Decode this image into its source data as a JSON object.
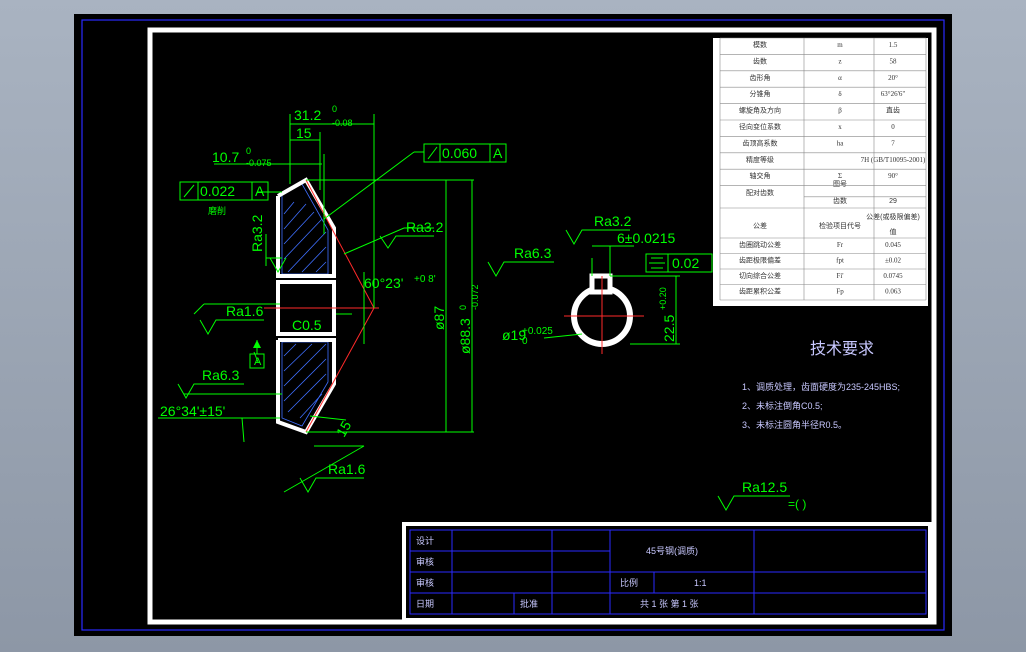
{
  "dims": {
    "d1": "31.2",
    "d1_upper": "0",
    "d1_lower": "-0.08",
    "d2": "15",
    "d3": "10.7",
    "d3_upper": "0",
    "d3_lower": "-0.075",
    "flatness1": "0.022",
    "flatness1_datum": "A",
    "flatness2": "0.060",
    "flatness2_datum": "A",
    "sym": "0.02",
    "angle1": "60°23'",
    "angle1_tol": "+0 8'",
    "angle2": "26°34'±15'",
    "chamfer": "C0.5",
    "dia87": "ø87",
    "dia88": "ø88.3",
    "dia88_upper": "0",
    "dia88_lower": "-0.072",
    "bore": "ø19",
    "bore_upper": "+0.025",
    "bore_lower": "0",
    "keywidth": "6±0.0215",
    "keydepth": "22.5",
    "keydepth_tol": "+0.20",
    "dim15b": "15",
    "datum": "A",
    "cn_label": "磨削"
  },
  "roughness": {
    "r1": "Ra3.2",
    "r2": "Ra3.2",
    "r3": "Ra6.3",
    "r4": "Ra1.6",
    "r5": "Ra6.3",
    "r6": "Ra1.6",
    "r7": "Ra3.2",
    "r_general": "Ra12.5",
    "r_general_suffix": "=( )"
  },
  "param_table": [
    [
      "模数",
      "m",
      "1.5"
    ],
    [
      "齿数",
      "z",
      "58"
    ],
    [
      "齿形角",
      "α",
      "20°"
    ],
    [
      "分锥角",
      "δ",
      "63°26'6\""
    ],
    [
      "螺旋角及方向",
      "β",
      "直齿"
    ],
    [
      "径向变位系数",
      "x",
      "0"
    ],
    [
      "齿顶高系数",
      "ha",
      "7"
    ],
    [
      "精度等级",
      "",
      "7H (GB/T10095-2001)"
    ],
    [
      "轴交角",
      "Σ",
      "90°"
    ]
  ],
  "mate_table": {
    "label": "配对齿数",
    "sub1": "图号",
    "sub2": "齿数",
    "value": "29"
  },
  "tol_header": {
    "col1": "公差",
    "col2": "检验项目代号",
    "col3a": "公差(或极限偏差)",
    "col3b": "值"
  },
  "tol_table": [
    [
      "齿圈跳动公差",
      "Fr",
      "0.045"
    ],
    [
      "齿距极限偏差",
      "fpt",
      "±0.02"
    ],
    [
      "切向综合公差",
      "Fi'",
      "0.0745"
    ],
    [
      "齿距累积公差",
      "Fp",
      "0.063"
    ]
  ],
  "notes": {
    "title": "技术要求",
    "items": [
      "1、调质处理，齿面硬度为235-245HBS;",
      "2、未标注倒角C0.5;",
      "3、未标注圆角半径R0.5。"
    ]
  },
  "title_block": {
    "r1": "设计",
    "r2": "审核",
    "r3": "审核",
    "r4": "日期",
    "material": "45号钢(调质)",
    "scale_label": "比例",
    "scale": "1:1",
    "sheets": "共 1 张   第 1 张",
    "mid": "批准"
  },
  "colors": {
    "outline": "#ffffff",
    "dims": "#00ff00",
    "hatch": "#3f6fff",
    "center": "#ff2a2a",
    "border": "#2a2aff",
    "table_bg": "#ffffff",
    "table_line": "#0000cc",
    "note": "#c8c8ff"
  }
}
